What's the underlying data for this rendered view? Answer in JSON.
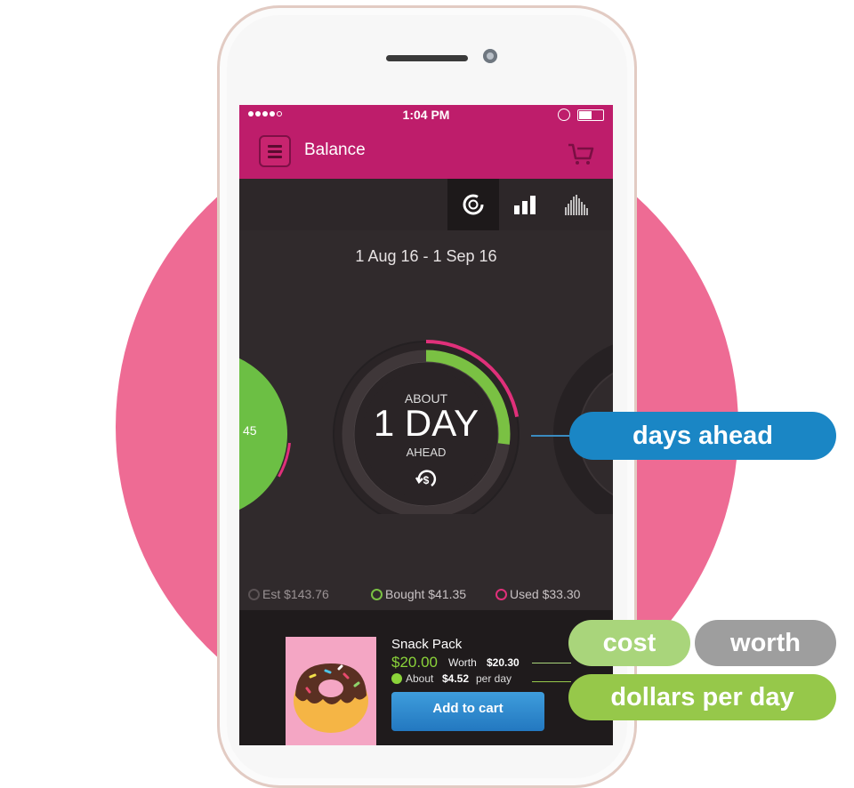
{
  "status_bar": {
    "time": "1:04 PM"
  },
  "app_bar": {
    "title": "Balance"
  },
  "view_tabs": [
    "ring-gauge-icon",
    "bar-chart-icon",
    "histogram-icon"
  ],
  "period": {
    "date_range": "1 Aug 16 - 1 Sep 16"
  },
  "gauge": {
    "about": "ABOUT",
    "value": "1 DAY",
    "suffix": "AHEAD",
    "bought_fraction": 0.27,
    "used_fraction": 0.22
  },
  "side_gauge": {
    "value": "45"
  },
  "legend": {
    "est": "Est $143.76",
    "bought": "Bought $41.35",
    "used": "Used $33.30"
  },
  "product": {
    "name": "Snack Pack",
    "price": "$20.00",
    "worth_label": "Worth",
    "worth_value": "$20.30",
    "per_day_about": "About",
    "per_day_value": "$4.52",
    "per_day_suffix": "per day",
    "add_to_cart": "Add to cart"
  },
  "callouts": {
    "days_ahead": "days ahead",
    "cost": "cost",
    "worth": "worth",
    "dollars_per_day": "dollars per day"
  },
  "colors": {
    "brand": "#be1d6b",
    "bought": "#7ac143",
    "used": "#e0307a",
    "callout_blue": "#1a86c5",
    "background_circle": "#ee6b94"
  }
}
